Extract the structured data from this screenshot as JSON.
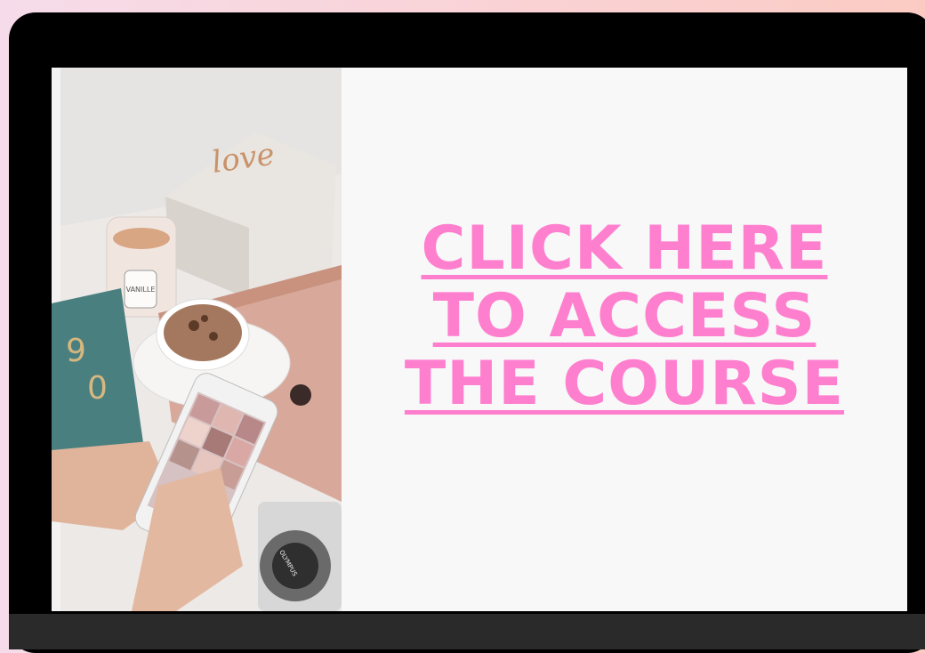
{
  "cta": {
    "line1": "CLICK HERE",
    "line2": "TO ACCESS",
    "line3": "THE COURSE",
    "color": "#ff7fcf"
  },
  "photo": {
    "box_text": "love",
    "candle_text": "VANILLE",
    "camera_text": "OLYMPUS"
  },
  "colors": {
    "laptop_frame": "#000000",
    "screen_bg": "#f8f8f8"
  }
}
